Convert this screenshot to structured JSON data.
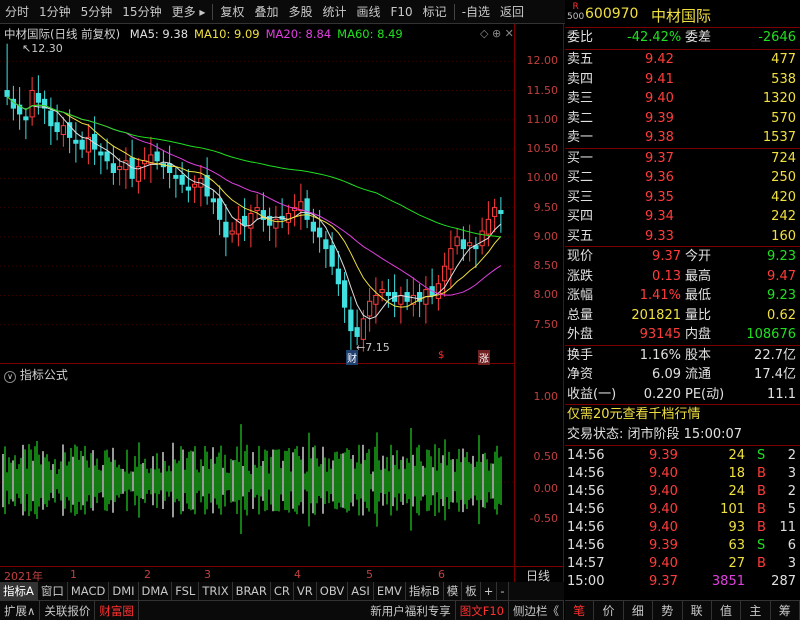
{
  "toolbar": {
    "items": [
      "分时",
      "1分钟",
      "5分钟",
      "15分钟",
      "更多",
      "复权",
      "叠加",
      "多股",
      "统计",
      "画线",
      "F10",
      "标记",
      "-自选",
      "返回"
    ]
  },
  "chart": {
    "title": "中材国际(日线 前复权)",
    "ma": [
      {
        "label": "MA5: 9.38",
        "color": "#e0e0e0"
      },
      {
        "label": "MA10: 9.09",
        "color": "#f0e040"
      },
      {
        "label": "MA20: 8.84",
        "color": "#e040e0"
      },
      {
        "label": "MA60: 8.49",
        "color": "#20e020"
      }
    ],
    "high_label": "12.30",
    "low_label": "7.15",
    "markers": [
      "财",
      "$",
      "涨"
    ],
    "y_ticks": [
      "12.00",
      "11.50",
      "11.00",
      "10.50",
      "10.00",
      "9.50",
      "9.00",
      "8.50",
      "8.00",
      "7.50"
    ]
  },
  "chart_data": {
    "type": "candlestick",
    "title": "中材国际(日线 前复权)",
    "ylim": [
      7.0,
      12.5
    ],
    "close": [
      11.4,
      11.2,
      11.1,
      11.0,
      11.5,
      11.3,
      11.2,
      10.9,
      10.8,
      10.9,
      10.7,
      10.6,
      10.5,
      10.7,
      10.5,
      10.4,
      10.3,
      10.1,
      10.2,
      10.3,
      10.0,
      10.2,
      10.3,
      10.4,
      10.3,
      10.2,
      10.1,
      10.0,
      9.9,
      9.8,
      9.9,
      10.0,
      9.7,
      9.6,
      9.3,
      9.0,
      9.1,
      9.3,
      9.2,
      9.4,
      9.5,
      9.3,
      9.2,
      9.3,
      9.3,
      9.4,
      9.5,
      9.6,
      9.3,
      9.1,
      9.0,
      8.8,
      8.5,
      8.2,
      7.8,
      7.4,
      7.3,
      7.6,
      7.9,
      8.0,
      8.1,
      8.0,
      7.9,
      8.0,
      7.9,
      8.0,
      7.9,
      8.1,
      8.0,
      8.2,
      8.5,
      8.8,
      9.0,
      8.8,
      8.9,
      8.8,
      9.1,
      9.3,
      9.5,
      9.4
    ],
    "ma_series": [
      {
        "name": "MA5",
        "last": 9.38
      },
      {
        "name": "MA10",
        "last": 9.09
      },
      {
        "name": "MA20",
        "last": 8.84
      },
      {
        "name": "MA60",
        "last": 8.49
      }
    ]
  },
  "indicator": {
    "title": "指标公式",
    "y_ticks": [
      "1.00",
      "0.50",
      "0.00",
      "-0.50"
    ]
  },
  "dates": {
    "labels": [
      "2021年",
      "1",
      "2",
      "3",
      "4",
      "5",
      "6"
    ],
    "period": "日线"
  },
  "tabs": [
    "指标A",
    "窗口",
    "MACD",
    "DMI",
    "DMA",
    "FSL",
    "TRIX",
    "BRAR",
    "CR",
    "VR",
    "OBV",
    "ASI",
    "EMV",
    "指标B",
    "模",
    "板",
    "+",
    "-"
  ],
  "status": [
    "扩展∧",
    "关联报价",
    "财富圈",
    "新用户福利专享",
    "图文F10",
    "侧边栏《"
  ],
  "quote": {
    "code": "600970",
    "name": "中材国际",
    "badge_r": "R",
    "badge_500": "500",
    "webi_label": "委比",
    "webi": "-42.42%",
    "weicha_label": "委差",
    "weicha": "-2646",
    "asks": [
      {
        "label": "卖五",
        "price": "9.42",
        "vol": "477"
      },
      {
        "label": "卖四",
        "price": "9.41",
        "vol": "538"
      },
      {
        "label": "卖三",
        "price": "9.40",
        "vol": "1320"
      },
      {
        "label": "卖二",
        "price": "9.39",
        "vol": "570"
      },
      {
        "label": "卖一",
        "price": "9.38",
        "vol": "1537"
      }
    ],
    "bids": [
      {
        "label": "买一",
        "price": "9.37",
        "vol": "724"
      },
      {
        "label": "买二",
        "price": "9.36",
        "vol": "250"
      },
      {
        "label": "买三",
        "price": "9.35",
        "vol": "420"
      },
      {
        "label": "买四",
        "price": "9.34",
        "vol": "242"
      },
      {
        "label": "买五",
        "price": "9.33",
        "vol": "160"
      }
    ],
    "stats": [
      {
        "l1": "现价",
        "v1": "9.37",
        "c1": "red",
        "l2": "今开",
        "v2": "9.23",
        "c2": "green"
      },
      {
        "l1": "涨跌",
        "v1": "0.13",
        "c1": "red",
        "l2": "最高",
        "v2": "9.47",
        "c2": "red"
      },
      {
        "l1": "涨幅",
        "v1": "1.41%",
        "c1": "red",
        "l2": "最低",
        "v2": "9.23",
        "c2": "green"
      },
      {
        "l1": "总量",
        "v1": "201821",
        "c1": "yellow",
        "l2": "量比",
        "v2": "0.62",
        "c2": "yellow"
      },
      {
        "l1": "外盘",
        "v1": "93145",
        "c1": "red",
        "l2": "内盘",
        "v2": "108676",
        "c2": "green"
      }
    ],
    "stats2": [
      {
        "l1": "换手",
        "v1": "1.16%",
        "l2": "股本",
        "v2": "22.7亿"
      },
      {
        "l1": "净资",
        "v1": "6.09",
        "l2": "流通",
        "v2": "17.4亿"
      },
      {
        "l1": "收益(一)",
        "v1": "0.220",
        "l2": "PE(动)",
        "v2": "11.1"
      }
    ],
    "promo": "仅需20元查看千档行情",
    "trade_state": "交易状态: 闭市阶段 15:00:07",
    "ticks": [
      {
        "time": "14:56",
        "price": "9.39",
        "vol": "24",
        "bs": "S",
        "n": "2"
      },
      {
        "time": "14:56",
        "price": "9.40",
        "vol": "18",
        "bs": "B",
        "n": "3"
      },
      {
        "time": "14:56",
        "price": "9.40",
        "vol": "24",
        "bs": "B",
        "n": "2"
      },
      {
        "time": "14:56",
        "price": "9.40",
        "vol": "101",
        "bs": "B",
        "n": "5"
      },
      {
        "time": "14:56",
        "price": "9.40",
        "vol": "93",
        "bs": "B",
        "n": "11"
      },
      {
        "time": "14:56",
        "price": "9.39",
        "vol": "63",
        "bs": "S",
        "n": "6"
      },
      {
        "time": "14:57",
        "price": "9.40",
        "vol": "27",
        "bs": "B",
        "n": "3"
      },
      {
        "time": "15:00",
        "price": "9.37",
        "vol": "3851",
        "bs": "",
        "n": "287"
      }
    ],
    "bottom_icons": [
      "笔",
      "价",
      "细",
      "势",
      "联",
      "值",
      "主",
      "筹"
    ]
  }
}
